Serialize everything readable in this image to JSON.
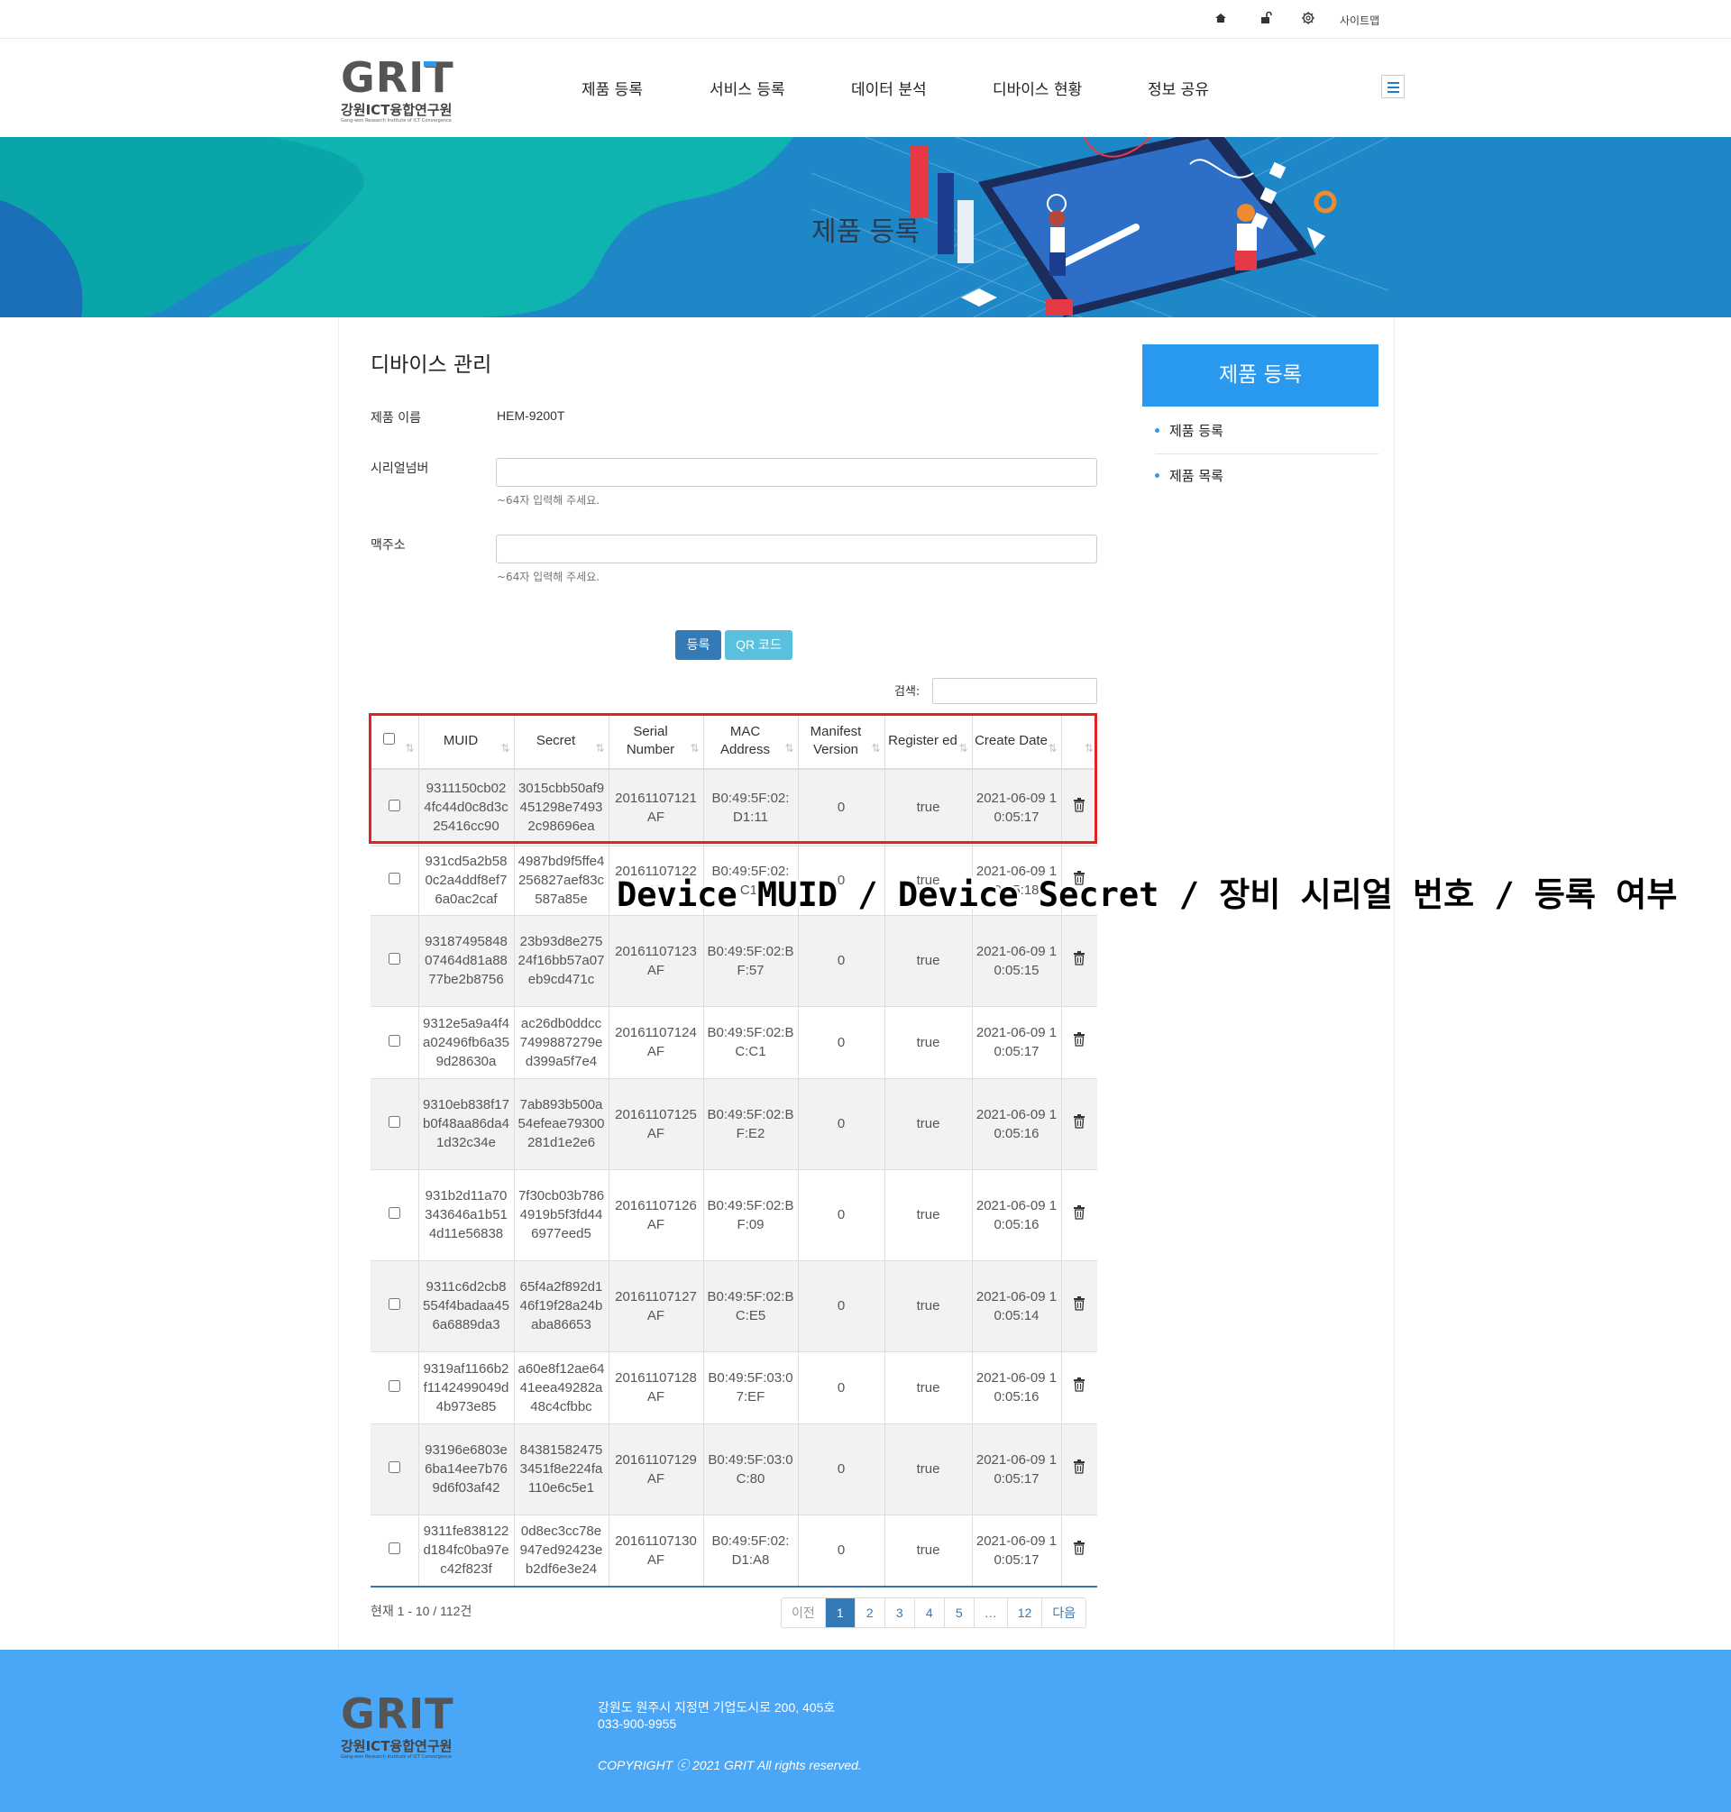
{
  "topbar": {
    "icons": [
      "home-icon",
      "lock-icon",
      "gear-icon"
    ],
    "sitemap_label": "사이트맵"
  },
  "header": {
    "logo_text": "GRIT",
    "logo_subtitle": "강원ICT융합연구원",
    "logo_tagline": "Gang-won Research Institute of ICT Convergence",
    "nav": [
      "제품 등록",
      "서비스 등록",
      "데이터 분석",
      "디바이스 현황",
      "정보 공유"
    ]
  },
  "banner": {
    "title": "제품 등록"
  },
  "form": {
    "section_title": "디바이스 관리",
    "product_name_label": "제품 이름",
    "product_name_value": "HEM-9200T",
    "serial_label": "시리얼넘버",
    "serial_value": "",
    "serial_hint": "~64자 입력해 주세요.",
    "mac_label": "맥주소",
    "mac_value": "",
    "mac_hint": "~64자 입력해 주세요.",
    "register_button": "등록",
    "qr_button": "QR 코드",
    "search_label": "검색:",
    "search_value": ""
  },
  "table": {
    "columns": [
      "MUID",
      "Secret",
      "Serial Number",
      "MAC Address",
      "Manifest Version",
      "Register ed",
      "Create Date"
    ],
    "rows": [
      {
        "muid": "9311150cb024fc44d0c8d3c25416cc90",
        "secret": "3015cbb50af9451298e74932c98696ea",
        "serial": "20161107121AF",
        "mac": "B0:49:5F:02:D1:11",
        "manifest": "0",
        "registered": "true",
        "created": "2021-06-09 10:05:17"
      },
      {
        "muid": "931cd5a2b580c2a4ddf8ef76a0ac2caf",
        "secret": "4987bd9f5ffe4256827aef83c587a85e",
        "serial": "20161107122AF",
        "mac": "B0:49:5F:02:C1:",
        "manifest": "0",
        "registered": "true",
        "created": "2021-06-09 10:05:18"
      },
      {
        "muid": "9318749584807464d81a8877be2b8756",
        "secret": "23b93d8e27524f16bb57a07eb9cd471c",
        "serial": "20161107123AF",
        "mac": "B0:49:5F:02:BF:57",
        "manifest": "0",
        "registered": "true",
        "created": "2021-06-09 10:05:15"
      },
      {
        "muid": "9312e5a9a4f4a02496fb6a359d28630a",
        "secret": "ac26db0ddcc7499887279ed399a5f7e4",
        "serial": "20161107124AF",
        "mac": "B0:49:5F:02:BC:C1",
        "manifest": "0",
        "registered": "true",
        "created": "2021-06-09 10:05:17"
      },
      {
        "muid": "9310eb838f17b0f48aa86da41d32c34e",
        "secret": "7ab893b500a54efeae79300281d1e2e6",
        "serial": "20161107125AF",
        "mac": "B0:49:5F:02:BF:E2",
        "manifest": "0",
        "registered": "true",
        "created": "2021-06-09 10:05:16"
      },
      {
        "muid": "931b2d11a70343646a1b514d11e56838",
        "secret": "7f30cb03b7864919b5f3fd446977eed5",
        "serial": "20161107126AF",
        "mac": "B0:49:5F:02:BF:09",
        "manifest": "0",
        "registered": "true",
        "created": "2021-06-09 10:05:16"
      },
      {
        "muid": "9311c6d2cb8554f4badaa456a6889da3",
        "secret": "65f4a2f892d146f19f28a24baba86653",
        "serial": "20161107127AF",
        "mac": "B0:49:5F:02:BC:E5",
        "manifest": "0",
        "registered": "true",
        "created": "2021-06-09 10:05:14"
      },
      {
        "muid": "9319af1166b2f1142499049d4b973e85",
        "secret": "a60e8f12ae6441eea49282a48c4cfbbc",
        "serial": "20161107128AF",
        "mac": "B0:49:5F:03:07:EF",
        "manifest": "0",
        "registered": "true",
        "created": "2021-06-09 10:05:16"
      },
      {
        "muid": "93196e6803e6ba14ee7b769d6f03af42",
        "secret": "843815824753451f8e224fa110e6c5e1",
        "serial": "20161107129AF",
        "mac": "B0:49:5F:03:0C:80",
        "manifest": "0",
        "registered": "true",
        "created": "2021-06-09 10:05:17"
      },
      {
        "muid": "9311fe838122d184fc0ba97ec42f823f",
        "secret": "0d8ec3cc78e947ed92423eb2df6e3e24",
        "serial": "20161107130AF",
        "mac": "B0:49:5F:02:D1:A8",
        "manifest": "0",
        "registered": "true",
        "created": "2021-06-09 10:05:17"
      }
    ],
    "summary": "현재 1 - 10 / 112건",
    "pagination": [
      "이전",
      "1",
      "2",
      "3",
      "4",
      "5",
      "…",
      "12",
      "다음"
    ],
    "active_page": "1"
  },
  "sidebar": {
    "heading": "제품 등록",
    "items": [
      "제품 등록",
      "제품 목록"
    ]
  },
  "footer": {
    "logo_text": "GRIT",
    "logo_subtitle": "강원ICT융합연구원",
    "logo_tagline": "Gang-won Research Institute of ICT Convergence",
    "address": "강원도 원주시 지정면 기업도시로 200, 405호",
    "phone": "033-900-9955",
    "copyright": "COPYRIGHT ⓒ 2021 GRIT All rights reserved."
  },
  "annotation": {
    "caption": "Device MUID / Device Secret / 장비 시리얼 번호 / 등록 여부",
    "color": "#e02222"
  },
  "colors": {
    "primary": "#2a9af1",
    "footer": "#4aa6f6",
    "button_register": "#337ab7",
    "button_qr": "#5bc0de"
  }
}
